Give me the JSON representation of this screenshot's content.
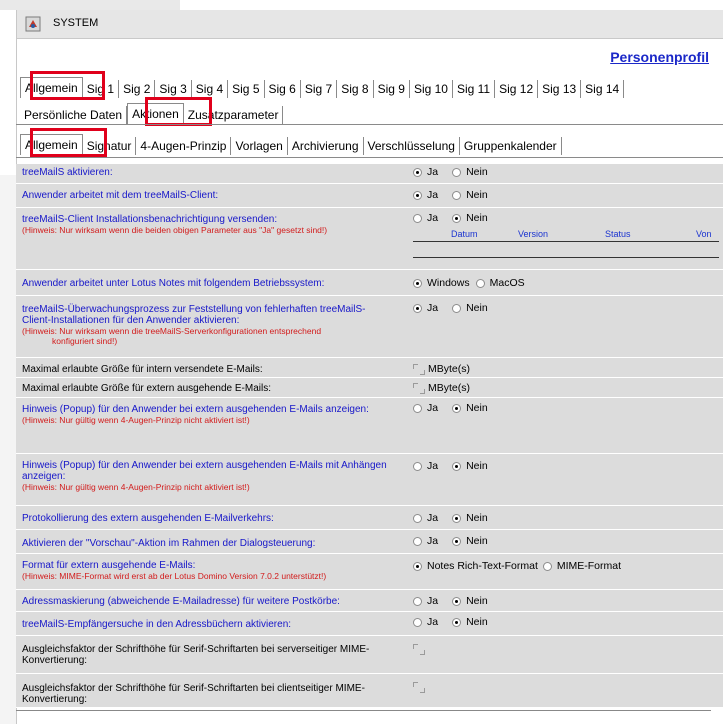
{
  "window": {
    "title": "SYSTEM"
  },
  "header": {
    "profile_link": "Personenprofil"
  },
  "tabs_sig": [
    "Allgemein",
    "Sig 1",
    "Sig 2",
    "Sig 3",
    "Sig 4",
    "Sig 5",
    "Sig 6",
    "Sig 7",
    "Sig 8",
    "Sig 9",
    "Sig 10",
    "Sig 11",
    "Sig 12",
    "Sig 13",
    "Sig 14"
  ],
  "tabs_section": [
    "Persönliche Daten",
    "Aktionen",
    "Zusatzparameter"
  ],
  "tabs_sub": [
    "Allgemein",
    "Signatur",
    "4-Augen-Prinzip",
    "Vorlagen",
    "Archivierung",
    "Verschlüsselung",
    "Gruppenkalender"
  ],
  "colors": {
    "highlight_box": "#e0001b",
    "label_blue": "#1717c9",
    "hint_red": "#d21b1b",
    "row_bg": "#dcdcdc",
    "link": "#1b28c8"
  },
  "rows": [
    {
      "label": "treeMailS aktivieren:",
      "opt1": "Ja",
      "opt2": "Nein",
      "selected": "Ja"
    },
    {
      "label": "Anwender arbeitet mit dem treeMailS-Client:",
      "opt1": "Ja",
      "opt2": "Nein",
      "selected": "Ja"
    },
    {
      "label": "treeMailS-Client Installationsbenachrichtigung versenden:",
      "hint": "(Hinweis: Nur wirksam wenn die beiden obigen Parameter aus \"Ja\" gesetzt sind!)",
      "opt1": "Ja",
      "opt2": "Nein",
      "selected": "Nein",
      "columns": [
        "Datum",
        "Version",
        "Status",
        "Von"
      ]
    },
    {
      "label": "Anwender arbeitet unter Lotus Notes mit folgendem Betriebssystem:",
      "opt1": "Windows",
      "opt2": "MacOS",
      "selected": "Windows"
    },
    {
      "label": "treeMailS-Überwachungsprozess zur Feststellung von fehlerhaften treeMailS-Client-Installationen für den Anwender aktivieren:",
      "hint": "(Hinweis: Nur wirksam wenn die treeMailS-Serverkonfigurationen entsprechend",
      "hint2": "konfiguriert sind!)",
      "opt1": "Ja",
      "opt2": "Nein",
      "selected": "Ja"
    },
    {
      "label": "Maximal erlaubte Größe für intern versendete E-Mails:",
      "unit": "MByte(s)"
    },
    {
      "label": "Maximal erlaubte Größe für extern ausgehende E-Mails:",
      "unit": "MByte(s)"
    },
    {
      "label": "Hinweis (Popup) für den Anwender bei extern ausgehenden E-Mails anzeigen:",
      "hint": "(Hinweis: Nur gültig wenn 4-Augen-Prinzip nicht aktiviert ist!)",
      "opt1": "Ja",
      "opt2": "Nein",
      "selected": "Nein"
    },
    {
      "label": "Hinweis (Popup) für den Anwender bei extern ausgehenden E-Mails mit Anhängen anzeigen:",
      "hint": "(Hinweis: Nur gültig wenn 4-Augen-Prinzip nicht aktiviert ist!)",
      "opt1": "Ja",
      "opt2": "Nein",
      "selected": "Nein"
    },
    {
      "label": "Protokollierung des extern ausgehenden E-Mailverkehrs:",
      "opt1": "Ja",
      "opt2": "Nein",
      "selected": "Nein"
    },
    {
      "label": "Aktivieren der \"Vorschau\"-Aktion im Rahmen der Dialogsteuerung:",
      "opt1": "Ja",
      "opt2": "Nein",
      "selected": "Nein"
    },
    {
      "label": "Format für extern ausgehende E-Mails:",
      "hint": "(Hinweis: MIME-Format wird erst ab der Lotus Domino Version 7.0.2 unterstützt!)",
      "opt1": "Notes Rich-Text-Format",
      "opt2": "MIME-Format",
      "selected": "Notes Rich-Text-Format"
    },
    {
      "label": "Adressmaskierung (abweichende E-Mailadresse) für weitere Postkörbe:",
      "opt1": "Ja",
      "opt2": "Nein",
      "selected": "Nein"
    },
    {
      "label": "treeMailS-Empfängersuche in den Adressbüchern aktivieren:",
      "opt1": "Ja",
      "opt2": "Nein",
      "selected": "Nein"
    },
    {
      "label": "Ausgleichsfaktor der Schrifthöhe für Serif-Schriftarten bei serverseitiger MIME-Konvertierung:"
    },
    {
      "label": "Ausgleichsfaktor der Schrifthöhe für Serif-Schriftarten bei clientseitiger MIME-Konvertierung:"
    }
  ]
}
